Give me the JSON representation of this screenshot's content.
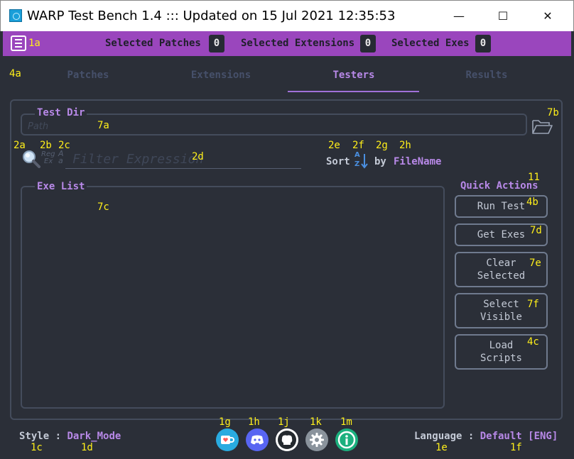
{
  "window": {
    "title": "WARP Test Bench 1.4  :::  Updated on 15 Jul 2021 12:35:53",
    "minimize_glyph": "—",
    "maximize_glyph": "☐",
    "close_glyph": "✕"
  },
  "topbar": {
    "menu_icon": "list-icon",
    "selected_patches_label": "Selected Patches",
    "selected_patches_count": "0",
    "selected_extensions_label": "Selected Extensions",
    "selected_extensions_count": "0",
    "selected_exes_label": "Selected Exes",
    "selected_exes_count": "0",
    "bar_color": "#9a46bd"
  },
  "tabs": [
    {
      "label": "Patches",
      "active": false
    },
    {
      "label": "Extensions",
      "active": false
    },
    {
      "label": "Testers",
      "active": true
    },
    {
      "label": "Results",
      "active": false
    }
  ],
  "tester": {
    "test_dir_label": "Test Dir",
    "path_placeholder": "Path",
    "folder_icon": "folder-open-icon",
    "search_icon": "magnifier-icon",
    "regex_toggle_top": "Reg",
    "regex_toggle_bottom": "Ex",
    "case_toggle_top": "A",
    "case_toggle_bottom": "a",
    "filter_placeholder": "Filter Expression",
    "sort_label": "Sort",
    "sort_order_top": "A",
    "sort_order_bottom": "Z",
    "by_label": "by",
    "sort_field": "FileName",
    "exe_list_label": "Exe List",
    "quick_actions_label": "Quick Actions",
    "buttons": [
      {
        "label": "Run Test"
      },
      {
        "label": "Get Exes"
      },
      {
        "label": "Clear\nSelected"
      },
      {
        "label": "Select\nVisible"
      },
      {
        "label": "Load\nScripts"
      }
    ]
  },
  "footer": {
    "style_label": "Style : ",
    "style_value": "Dark_Mode",
    "language_label": "Language : ",
    "language_value": "Default [ENG]",
    "icons": [
      "kofi-cup-icon",
      "discord-icon",
      "github-icon",
      "settings-gear-icon",
      "info-icon"
    ]
  },
  "annotations": {
    "a1a": "1a",
    "a4a": "4a",
    "a7a": "7a",
    "a7b": "7b",
    "a2a": "2a",
    "a2b": "2b",
    "a2c": "2c",
    "a2d": "2d",
    "a2e": "2e",
    "a2f": "2f",
    "a2g": "2g",
    "a2h": "2h",
    "a7c": "7c",
    "a11": "11",
    "a4b": "4b",
    "a7d": "7d",
    "a7e": "7e",
    "a7f": "7f",
    "a4c": "4c",
    "a1g": "1g",
    "a1h": "1h",
    "a1j": "1j",
    "a1k": "1k",
    "a1m": "1m",
    "a1c": "1c",
    "a1d": "1d",
    "a1e": "1e",
    "a1f": "1f"
  }
}
